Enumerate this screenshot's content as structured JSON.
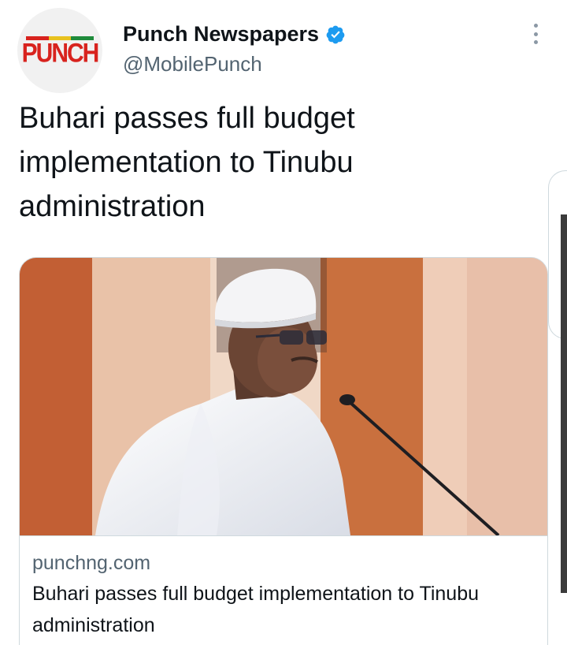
{
  "tweet": {
    "author": {
      "display_name": "Punch Newspapers",
      "handle": "@MobilePunch",
      "verified": true,
      "avatar_logo_text": "PUNCH"
    },
    "text": "Buhari passes full budget implementation to Tinubu administration",
    "more_icon": "more-vertical-icon",
    "link_card": {
      "domain": "punchng.com",
      "title": "Buhari passes full budget implementation to Tinubu administration"
    }
  },
  "colors": {
    "verified": "#1d9bf0",
    "logo_red": "#d8231e",
    "flag_green": "#1f8b3b",
    "secondary_text": "#536471"
  }
}
